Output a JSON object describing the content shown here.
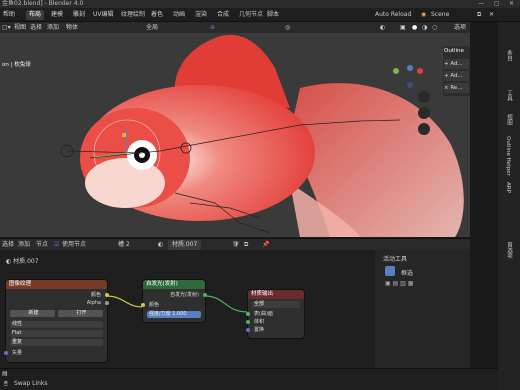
{
  "window": {
    "title": "金鱼02.blend] - Blender 4.0"
  },
  "topbar": {
    "tabs": [
      "帮助",
      "布局",
      "建模",
      "雕刻",
      "UV编辑",
      "纹理绘制",
      "着色",
      "动画",
      "渲染",
      "合成",
      "几何节点",
      "脚本"
    ],
    "active_tab": "布局",
    "auto_reload": "Auto Reload",
    "scene": "Scene"
  },
  "viewport_header": {
    "items": [
      "视图",
      "选择",
      "添加",
      "物体"
    ],
    "transform": "全局",
    "options": "选项",
    "overlay_text": "on | 枕兔球"
  },
  "outline_panel": {
    "title": "Outline",
    "items": [
      "+ Ad...",
      "+ Ad...",
      "× Re..."
    ]
  },
  "right_tabs": [
    "条目",
    "工具",
    "视图",
    "Outline Helper",
    "ARP",
    "首选项"
  ],
  "node_header": {
    "items": [
      "选择",
      "添加",
      "节点"
    ],
    "use_nodes_label": "使用节点",
    "slot": "槽 2",
    "material": "材质.007",
    "material_label": "材质.007"
  },
  "nodes": {
    "image": {
      "title": "图像纹理",
      "out_color": "颜色",
      "out_alpha": "Alpha",
      "new": "新建",
      "open": "打开",
      "interp": "线性",
      "proj": "Flat",
      "ext": "重复",
      "vector": "矢量"
    },
    "emission": {
      "title": "自发光(发射)",
      "output": "自发光(发射)",
      "color": "颜色",
      "strength_label": "强度/力度",
      "strength_value": "1.000"
    },
    "output": {
      "title": "材质输出",
      "target": "全部",
      "surface": "表(曲)面",
      "volume": "体积",
      "displacement": "置换"
    }
  },
  "side_panel": {
    "title": "活动工具",
    "tool": "框选"
  },
  "footer": {
    "swap_links": "Swap Links"
  },
  "colors": {
    "accent": "#5680c2",
    "image_node": "#7a3a2a",
    "shader_node": "#2e6a3a",
    "output_node": "#6a2a2e",
    "fish": "#e8443e"
  }
}
